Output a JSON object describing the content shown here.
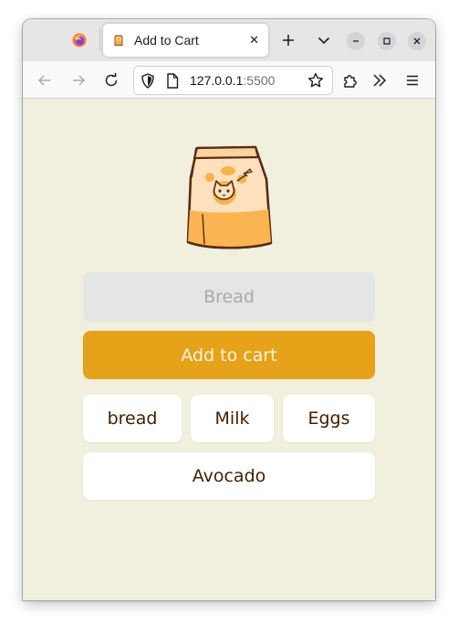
{
  "browser": {
    "tab_title": "Add to Cart",
    "url_host": "127.0.0.1",
    "url_port": ":5500"
  },
  "icons": {
    "firefox": "firefox-logo-icon",
    "favicon": "grocery-bag-favicon",
    "close_tab": "close-icon",
    "new_tab": "plus-icon",
    "list_tabs": "chevron-down-icon",
    "minimize": "minimize-icon",
    "maximize": "maximize-icon",
    "close_window": "close-icon",
    "back": "arrow-left-icon",
    "forward": "arrow-right-icon",
    "reload": "reload-icon",
    "shield": "shield-icon",
    "page": "page-icon",
    "bookmark": "star-icon",
    "extensions": "puzzle-icon",
    "overflow": "chevrons-right-icon",
    "menu": "hamburger-menu-icon"
  },
  "app": {
    "input_placeholder": "Bread",
    "add_button_label": "Add to cart",
    "items": [
      "bread",
      "Milk",
      "Eggs",
      "Avocado"
    ]
  },
  "colors": {
    "page_background": "#f1efdd",
    "accent": "#e6a219",
    "item_text": "#432000"
  }
}
